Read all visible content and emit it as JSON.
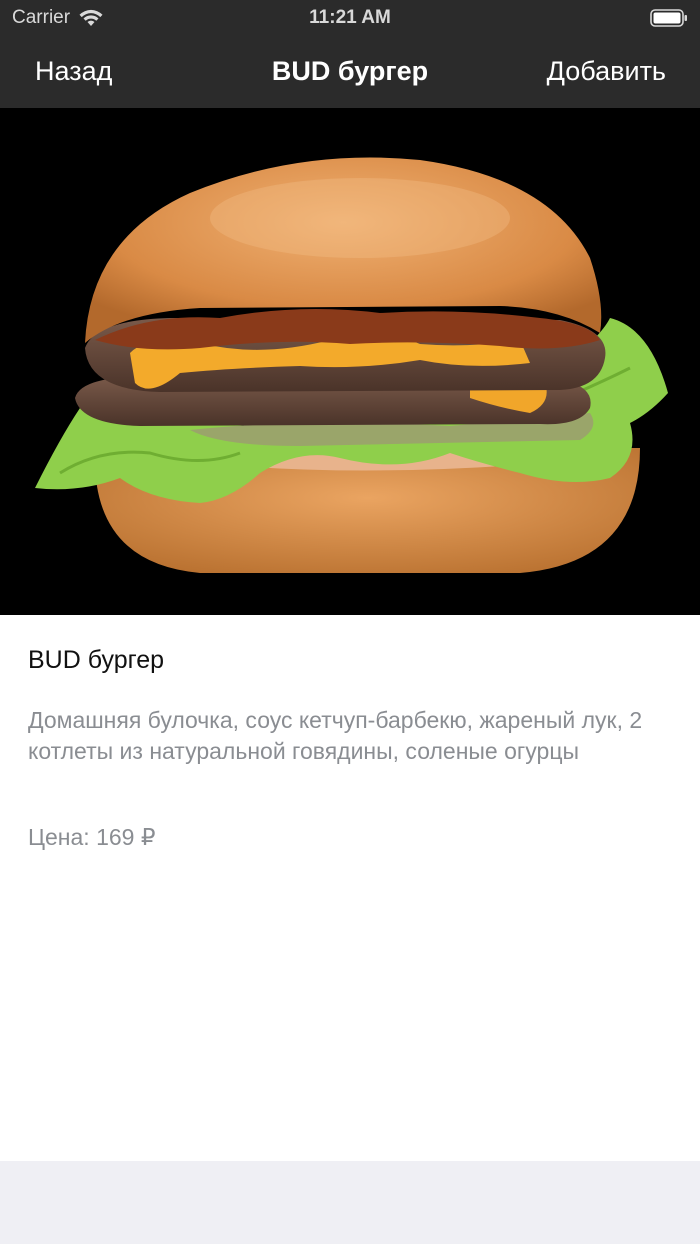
{
  "status_bar": {
    "carrier": "Carrier",
    "time": "11:21 AM",
    "wifi_icon": "wifi-icon",
    "battery_icon": "battery-icon"
  },
  "nav": {
    "back_label": "Назад",
    "title": "BUD бургер",
    "add_label": "Добавить"
  },
  "product": {
    "image": "burger-photo",
    "name": "BUD бургер",
    "description": "Домашняя булочка, соус кетчуп-барбекю, жареный лук, 2 котлеты из натуральной говядины, соленые огурцы",
    "price": "Цена: 169 ₽"
  },
  "colors": {
    "nav_background": "#2b2b2b",
    "photo_background": "#000000",
    "secondary_text": "#8a8d92",
    "bottom_bar": "#efeff4"
  }
}
